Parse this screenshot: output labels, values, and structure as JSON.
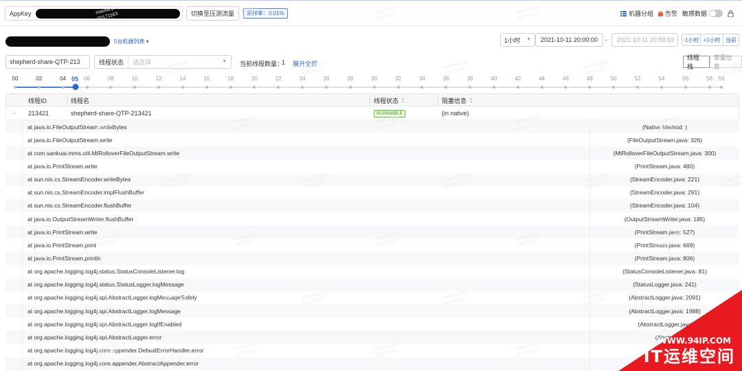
{
  "topbar": {
    "appkey_label": "AppKey",
    "switch_label": "切换至压测流量",
    "sample_rate": "采样率：0.01%",
    "machine_group": "机器分组",
    "alert": "告警",
    "sensitive_data": "敏感数据"
  },
  "filters": {
    "machine_list": "5台机器列表 ▾",
    "range": "1小时",
    "start_time": "2021-10-11 20:00:00",
    "separator": "-",
    "end_time": "2021-10-11 20:59:59",
    "minus_hour": "-1小时",
    "plus_hour": "+1小时",
    "current": "当前",
    "thread_name_value": "shepherd-share-QTP-213",
    "thread_state_label": "线程状态",
    "thread_state_placeholder": "请选择",
    "thread_count_label": "当前线程数量：",
    "thread_count": "1",
    "expand_all": "展开全部",
    "tab_stack": "线程栈",
    "tab_resident": "常量信息"
  },
  "timeline": {
    "labels": [
      "00",
      "02",
      "04",
      "05",
      "06",
      "08",
      "10",
      "12",
      "14",
      "16",
      "18",
      "20",
      "22",
      "24",
      "26",
      "28",
      "30",
      "32",
      "34",
      "36",
      "38",
      "40",
      "42",
      "44",
      "46",
      "48",
      "50",
      "52",
      "54",
      "56",
      "58",
      "59"
    ],
    "selected": "05"
  },
  "table": {
    "headers": {
      "thread_id": "线程ID",
      "thread_name": "线程名",
      "thread_state": "线程状态",
      "block_info": "阻塞信息"
    },
    "row": {
      "thread_id": "213421",
      "thread_name": "shepherd-share-QTP-213421",
      "thread_state": "RUNNABLE",
      "block_info": "(in native)"
    },
    "stack": [
      {
        "method": "at java.io.FileOutputStream.writeBytes",
        "source": "(Native Method: )"
      },
      {
        "method": "at java.io.FileOutputStream.write",
        "source": "(FileOutputStream.java: 326)"
      },
      {
        "method": "at com.sankuai.mms.util.MtRolloverFileOutputStream.write",
        "source": "(MtRolloverFileOutputStream.java: 300)"
      },
      {
        "method": "at java.io.PrintStream.write",
        "source": "(PrintStream.java: 480)"
      },
      {
        "method": "at sun.nio.cs.StreamEncoder.writeBytes",
        "source": "(StreamEncoder.java: 221)"
      },
      {
        "method": "at sun.nio.cs.StreamEncoder.implFlushBuffer",
        "source": "(StreamEncoder.java: 291)"
      },
      {
        "method": "at sun.nio.cs.StreamEncoder.flushBuffer",
        "source": "(StreamEncoder.java: 104)"
      },
      {
        "method": "at java.io.OutputStreamWriter.flushBuffer",
        "source": "(OutputStreamWriter.java: 185)"
      },
      {
        "method": "at java.io.PrintStream.write",
        "source": "(PrintStream.java: 527)"
      },
      {
        "method": "at java.io.PrintStream.print",
        "source": "(PrintStream.java: 669)"
      },
      {
        "method": "at java.io.PrintStream.println",
        "source": "(PrintStream.java: 806)"
      },
      {
        "method": "at org.apache.logging.log4j.status.StatusConsoleListener.log",
        "source": "(StatusConsoleListener.java: 81)"
      },
      {
        "method": "at org.apache.logging.log4j.status.StatusLogger.logMessage",
        "source": "(StatusLogger.java: 241)"
      },
      {
        "method": "at org.apache.logging.log4j.spi.AbstractLogger.logMessageSafely",
        "source": "(AbstractLogger.java: 2091)"
      },
      {
        "method": "at org.apache.logging.log4j.spi.AbstractLogger.logMessage",
        "source": "(AbstractLogger.java: 1988)"
      },
      {
        "method": "at org.apache.logging.log4j.spi.AbstractLogger.logIfEnabled",
        "source": "(AbstractLogger.java"
      },
      {
        "method": "at org.apache.logging.log4j.spi.AbstractLogger.error",
        "source": "(Abstra"
      },
      {
        "method": "at org.apache.logging.log4j.core.appender.DefaultErrorHandler.error",
        "source": ""
      },
      {
        "method": "at org.apache.logging.log4j.core.appender.AbstractAppender.error",
        "source": ""
      }
    ]
  },
  "watermark": {
    "line1": "maofanying",
    "line2": "00171163"
  },
  "badge": {
    "url": "WWW.94IP.COM",
    "name": "IT运维空间",
    "color": "#e8191f"
  }
}
